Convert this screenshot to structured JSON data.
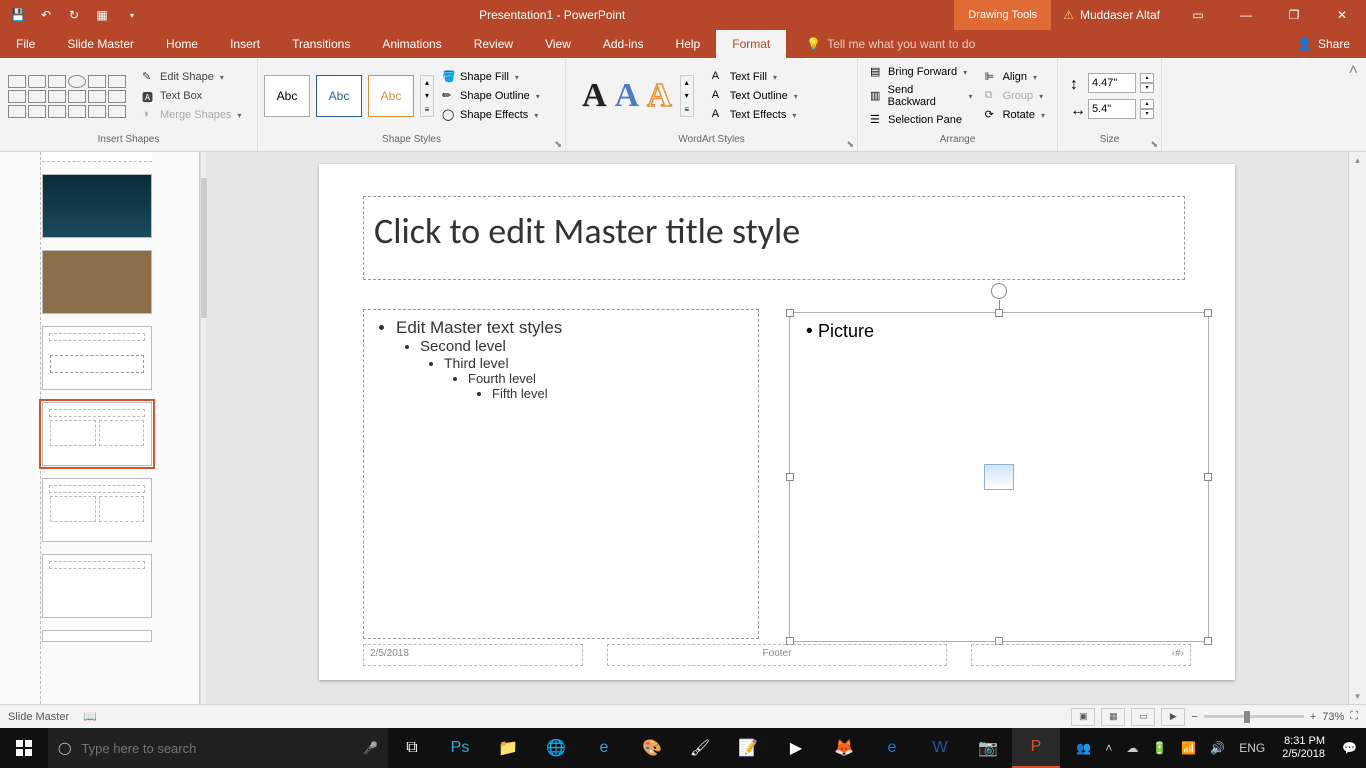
{
  "title": "Presentation1 - PowerPoint",
  "tools_tab": "Drawing Tools",
  "user": "Muddaser Altaf",
  "menu": {
    "file": "File",
    "slide_master": "Slide Master",
    "home": "Home",
    "insert": "Insert",
    "transitions": "Transitions",
    "animations": "Animations",
    "review": "Review",
    "view": "View",
    "addins": "Add-ins",
    "help": "Help",
    "format": "Format",
    "tell_me": "Tell me what you want to do",
    "share": "Share"
  },
  "ribbon": {
    "insert_shapes": {
      "label": "Insert Shapes",
      "edit_shape": "Edit Shape",
      "text_box": "Text Box",
      "merge_shapes": "Merge Shapes"
    },
    "shape_styles": {
      "label": "Shape Styles",
      "swatch": "Abc",
      "fill": "Shape Fill",
      "outline": "Shape Outline",
      "effects": "Shape Effects"
    },
    "wordart": {
      "label": "WordArt Styles",
      "text_fill": "Text Fill",
      "text_outline": "Text Outline",
      "text_effects": "Text Effects"
    },
    "arrange": {
      "label": "Arrange",
      "bring_forward": "Bring Forward",
      "send_backward": "Send Backward",
      "selection_pane": "Selection Pane",
      "align": "Align",
      "group": "Group",
      "rotate": "Rotate"
    },
    "size": {
      "label": "Size",
      "height": "4.47\"",
      "width": "5.4\""
    }
  },
  "slide": {
    "title_ph": "Click to edit Master title style",
    "bullets": {
      "l1": "Edit Master text styles",
      "l2": "Second level",
      "l3": "Third level",
      "l4": "Fourth level",
      "l5": "Fifth level"
    },
    "picture": "Picture",
    "footer_date": "2/5/2018",
    "footer_text": "Footer",
    "footer_num": "‹#›"
  },
  "statusbar": {
    "mode": "Slide Master",
    "zoom": "73%"
  },
  "taskbar": {
    "search_ph": "Type here to search",
    "time": "8:31 PM",
    "date": "2/5/2018"
  }
}
